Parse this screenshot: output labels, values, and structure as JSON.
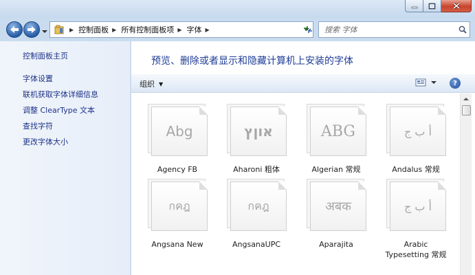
{
  "nav": {
    "breadcrumbs": [
      "控制面板",
      "所有控制面板项",
      "字体"
    ],
    "search_placeholder": "搜索 字体"
  },
  "sidebar": {
    "home_link": "控制面板主页",
    "links": [
      "字体设置",
      "联机获取字体详细信息",
      "调整 ClearType 文本",
      "查找字符",
      "更改字体大小"
    ]
  },
  "main": {
    "title": "预览、删除或者显示和隐藏计算机上安装的字体",
    "organize_label": "组织",
    "help_label": "?"
  },
  "fonts": [
    {
      "name": "Agency FB",
      "sample": "Abg"
    },
    {
      "name": "Aharoni 粗体",
      "sample": "אוןץ"
    },
    {
      "name": "Algerian 常规",
      "sample": "ABG"
    },
    {
      "name": "Andalus 常规",
      "sample": "أ ب ج"
    },
    {
      "name": "Angsana New",
      "sample": "กคฎ"
    },
    {
      "name": "AngsanaUPC",
      "sample": "กคฎ"
    },
    {
      "name": "Aparajita",
      "sample": "अबक"
    },
    {
      "name": "Arabic Typesetting 常规",
      "sample": "أ ب ج"
    }
  ],
  "icons": {
    "back": "back-arrow-icon",
    "forward": "forward-arrow-icon",
    "folder": "control-panel-folder-icon",
    "refresh": "refresh-icon",
    "search": "search-icon",
    "view": "view-options-icon",
    "help": "help-icon"
  },
  "colors": {
    "link": "#1e3287",
    "title": "#1e3c96",
    "close_button": "#c7432c"
  }
}
